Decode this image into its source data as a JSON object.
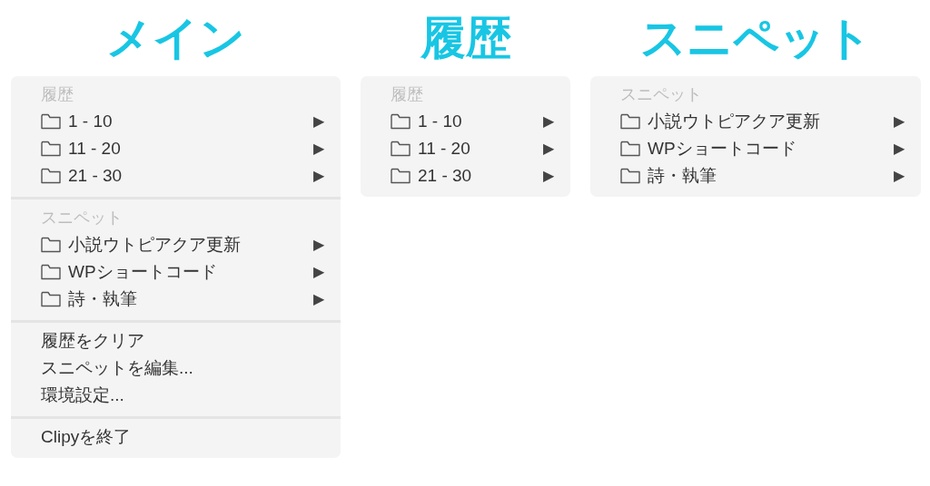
{
  "panels": [
    {
      "title": "メイン",
      "sections": [
        {
          "header": "履歴",
          "items": [
            {
              "kind": "folder",
              "label": "1 - 10",
              "arrow": "▶"
            },
            {
              "kind": "folder",
              "label": "11 - 20",
              "arrow": "▶"
            },
            {
              "kind": "folder",
              "label": "21 - 30",
              "arrow": "▶"
            }
          ]
        },
        {
          "header": "スニペット",
          "items": [
            {
              "kind": "folder",
              "label": "小説ウトピアクア更新",
              "arrow": "▶"
            },
            {
              "kind": "folder",
              "label": "WPショートコード",
              "arrow": "▶"
            },
            {
              "kind": "folder",
              "label": "詩・執筆",
              "arrow": "▶"
            }
          ]
        },
        {
          "items": [
            {
              "kind": "action",
              "label": "履歴をクリア"
            },
            {
              "kind": "action",
              "label": "スニペットを編集..."
            },
            {
              "kind": "action",
              "label": "環境設定..."
            }
          ]
        },
        {
          "items": [
            {
              "kind": "action",
              "label": "Clipyを終了"
            }
          ]
        }
      ]
    },
    {
      "title": "履歴",
      "sections": [
        {
          "header": "履歴",
          "items": [
            {
              "kind": "folder",
              "label": "1 - 10",
              "arrow": "▶"
            },
            {
              "kind": "folder",
              "label": "11 - 20",
              "arrow": "▶"
            },
            {
              "kind": "folder",
              "label": "21 - 30",
              "arrow": "▶"
            }
          ]
        }
      ]
    },
    {
      "title": "スニペット",
      "sections": [
        {
          "header": "スニペット",
          "items": [
            {
              "kind": "folder",
              "label": "小説ウトピアクア更新",
              "arrow": "▶"
            },
            {
              "kind": "folder",
              "label": "WPショートコード",
              "arrow": "▶"
            },
            {
              "kind": "folder",
              "label": "詩・執筆",
              "arrow": "▶"
            }
          ]
        }
      ]
    }
  ]
}
